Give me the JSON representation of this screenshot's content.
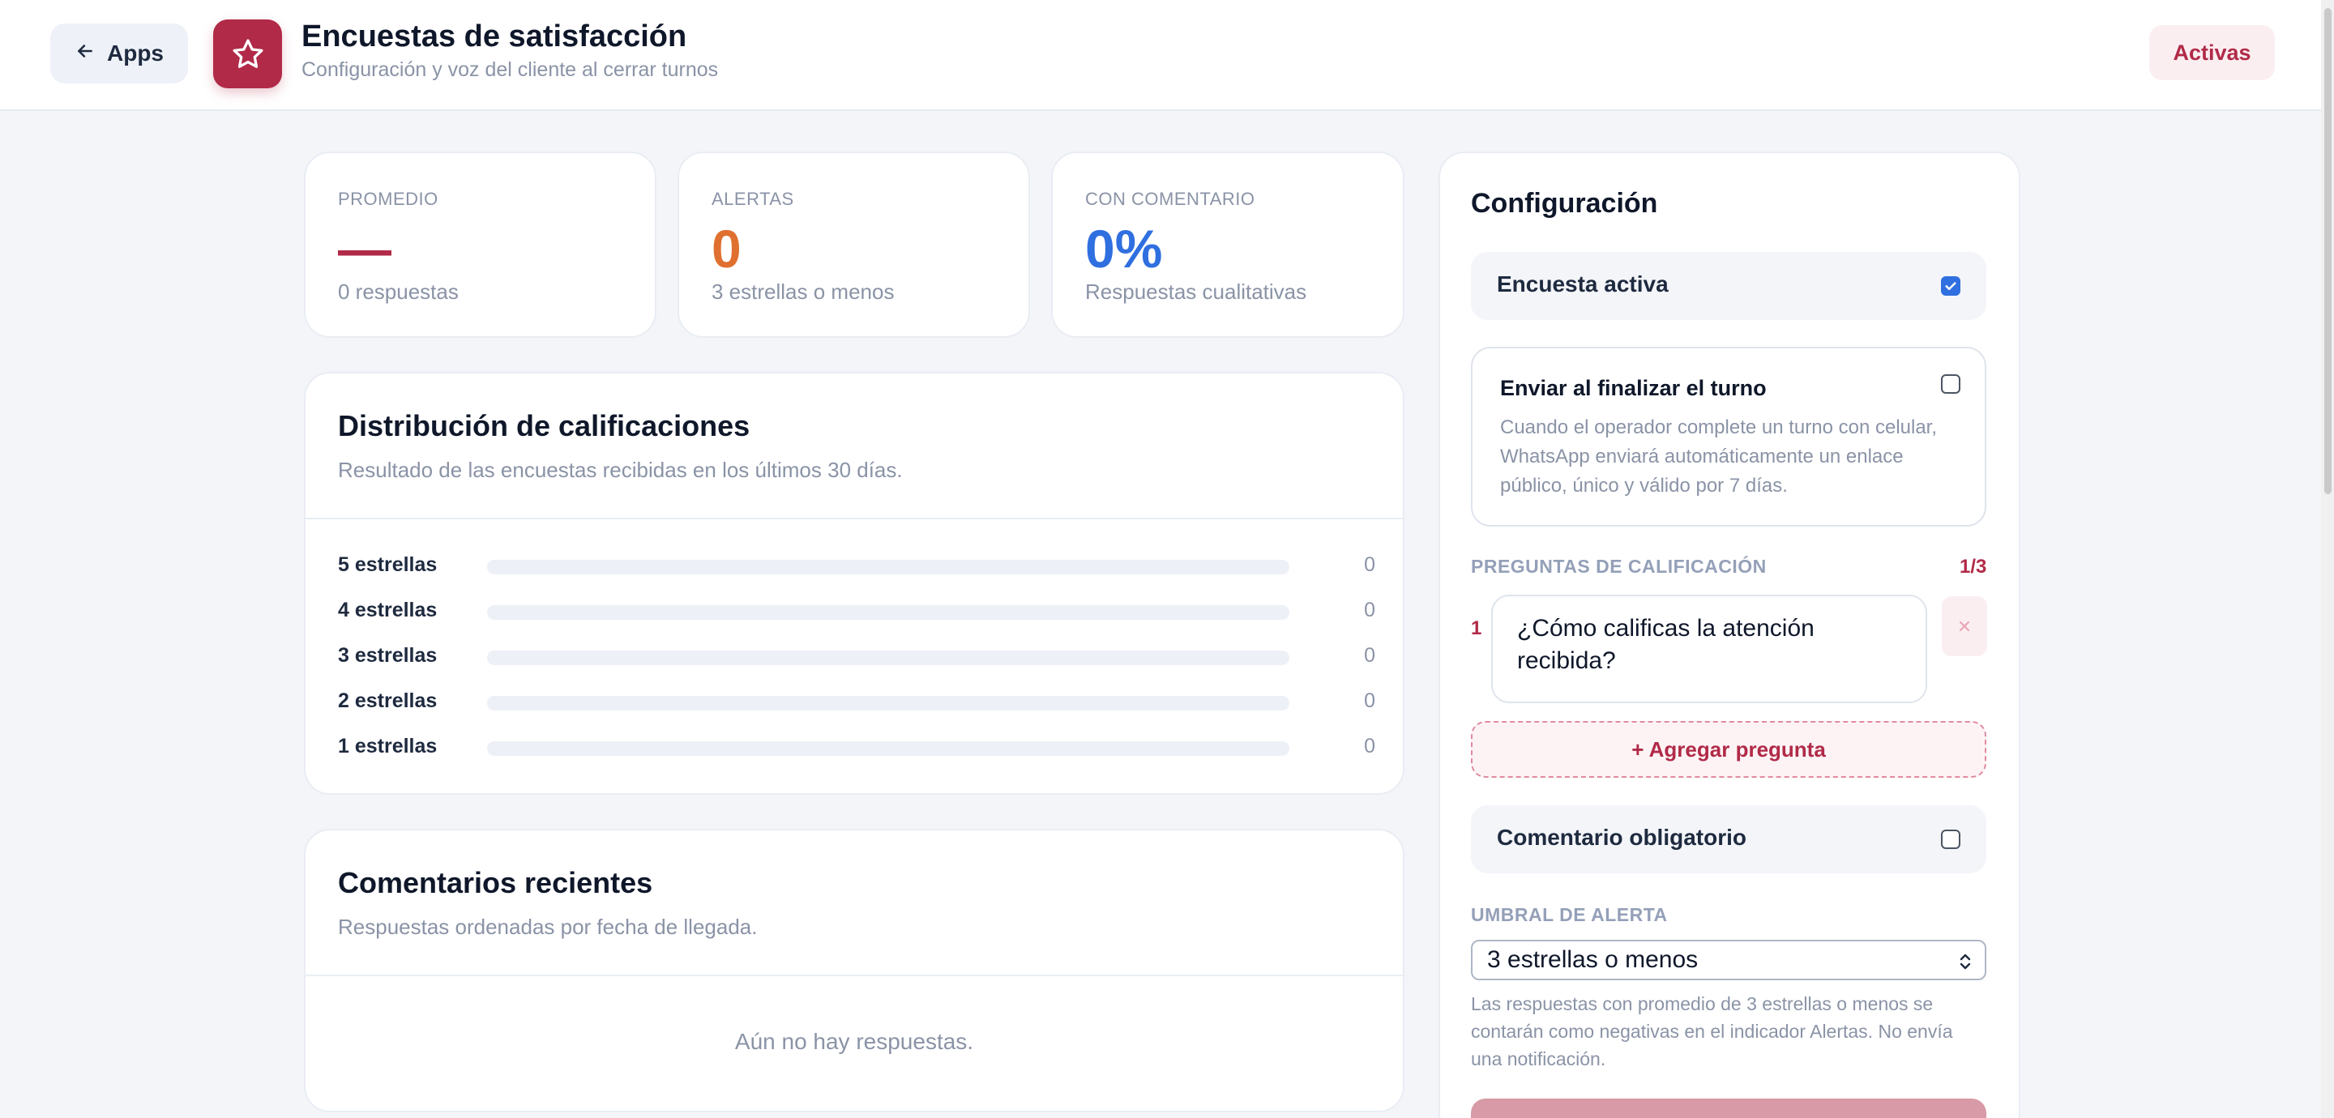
{
  "header": {
    "back_label": "Apps",
    "title": "Encuestas de satisfacción",
    "subtitle": "Configuración y voz del cliente al cerrar turnos",
    "status": "Activas"
  },
  "stats": [
    {
      "label": "PROMEDIO",
      "value": "—",
      "sub": "0 respuestas",
      "color": "#b12a48"
    },
    {
      "label": "ALERTAS",
      "value": "0",
      "sub": "3 estrellas o menos",
      "color": "#e07030"
    },
    {
      "label": "CON COMENTARIO",
      "value": "0%",
      "sub": "Respuestas cualitativas",
      "color": "#2f6fe0"
    }
  ],
  "distribution": {
    "title": "Distribución de calificaciones",
    "subtitle": "Resultado de las encuestas recibidas en los últimos 30 días.",
    "rows": [
      {
        "label": "5 estrellas",
        "count": "0",
        "fraction": 0
      },
      {
        "label": "4 estrellas",
        "count": "0",
        "fraction": 0
      },
      {
        "label": "3 estrellas",
        "count": "0",
        "fraction": 0
      },
      {
        "label": "2 estrellas",
        "count": "0",
        "fraction": 0
      },
      {
        "label": "1 estrellas",
        "count": "0",
        "fraction": 0
      }
    ]
  },
  "comments": {
    "title": "Comentarios recientes",
    "subtitle": "Respuestas ordenadas por fecha de llegada.",
    "empty": "Aún no hay respuestas."
  },
  "config": {
    "title": "Configuración",
    "active_label": "Encuesta activa",
    "active_checked": true,
    "send_title": "Enviar al finalizar el turno",
    "send_desc": "Cuando el operador complete un turno con celular, WhatsApp enviará automáticamente un enlace público, único y válido por 7 días.",
    "send_checked": false,
    "questions_heading": "PREGUNTAS DE CALIFICACIÓN",
    "questions_count": "1/3",
    "questions": [
      {
        "number": "1",
        "text": "¿Cómo calificas la atención recibida?"
      }
    ],
    "add_question": "+ Agregar pregunta",
    "comment_required_label": "Comentario obligatorio",
    "comment_required_checked": false,
    "threshold_heading": "UMBRAL DE ALERTA",
    "threshold_value": "3 estrellas o menos",
    "threshold_help": "Las respuestas con promedio de 3 estrellas o menos se contarán como negativas en el indicador Alertas. No envía una notificación."
  }
}
